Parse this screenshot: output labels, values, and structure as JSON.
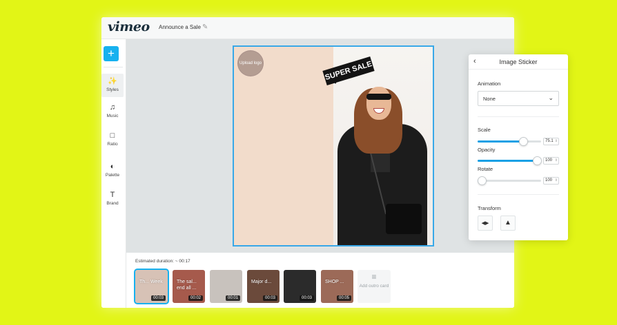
{
  "colors": {
    "background": "#e2f516",
    "accent": "#17b1ef",
    "slider": "#17a0e5"
  },
  "topbar": {
    "logo": "vimeo",
    "project_title": "Announce a Sale",
    "edit_icon": "pencil-icon"
  },
  "sidebar": {
    "add_label": "+",
    "items": [
      {
        "label": "Styles",
        "icon": "magic-wand-icon",
        "glyph": "✨"
      },
      {
        "label": "Music",
        "icon": "music-icon",
        "glyph": "♫"
      },
      {
        "label": "Ratio",
        "icon": "ratio-icon",
        "glyph": "□"
      },
      {
        "label": "Palette",
        "icon": "palette-icon",
        "glyph": "◐"
      },
      {
        "label": "Brand",
        "icon": "brand-icon",
        "glyph": "Τ"
      }
    ]
  },
  "canvas": {
    "upload_logo": "Upload logo",
    "sticker_text": "SUPER SALE"
  },
  "panel": {
    "title": "Image Sticker",
    "back_glyph": "‹",
    "animation_label": "Animation",
    "animation_value": "None",
    "chevron_glyph": "⌄",
    "scale_label": "Scale",
    "scale_value": "75.1",
    "scale_fraction": 0.72,
    "opacity_label": "Opacity",
    "opacity_value": "100",
    "opacity_fraction": 0.93,
    "rotate_label": "Rotate",
    "rotate_value": "100",
    "rotate_fraction": 0.07,
    "transform_label": "Transform",
    "flip_horizontal_glyph": "◀▶",
    "flip_vertical_glyph": "▲"
  },
  "timeline": {
    "estimated_duration": "Estimated duration: ~ 00:17",
    "clips": [
      {
        "text": "Th... Week",
        "duration": "00:03",
        "color": "#d7c2b6"
      },
      {
        "text": "The sal... end all ...",
        "duration": "00:02",
        "color": "#a65a4c"
      },
      {
        "text": "",
        "duration": "00:01",
        "color": "#c8c2bd"
      },
      {
        "text": "Major d...",
        "duration": "00:03",
        "color": "#6b4a3b"
      },
      {
        "text": "",
        "duration": "00:03",
        "color": "#2b2b2b"
      },
      {
        "text": "SHOP ...",
        "duration": "00:05",
        "color": "#9c6a58"
      }
    ],
    "outro_label": "Add outro card",
    "outro_glyph": "≡"
  }
}
